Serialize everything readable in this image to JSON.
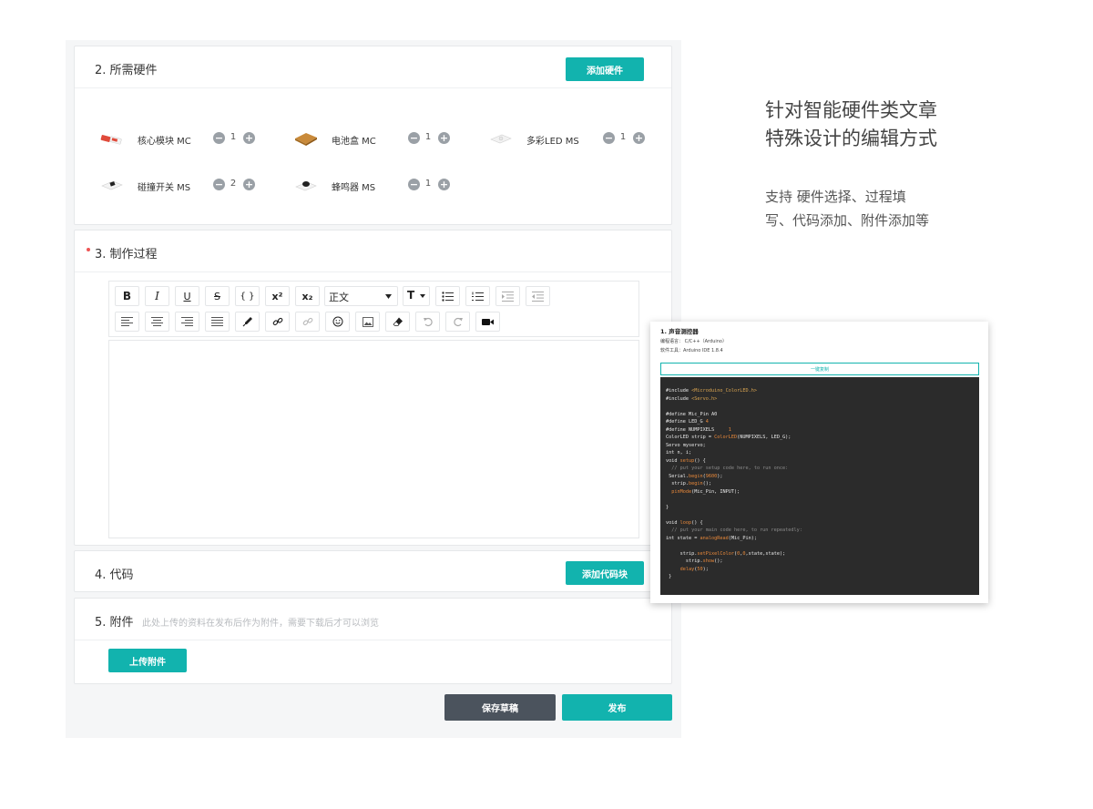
{
  "sections": {
    "hardware": {
      "title": "2. 所需硬件",
      "add_button": "添加硬件",
      "items": [
        {
          "name": "核心模块 MC",
          "count": "1",
          "icon": "core-module-icon"
        },
        {
          "name": "电池盒 MC",
          "count": "1",
          "icon": "battery-box-icon"
        },
        {
          "name": "多彩LED MS",
          "count": "1",
          "icon": "led-module-icon"
        },
        {
          "name": "碰撞开关 MS",
          "count": "2",
          "icon": "crash-switch-icon"
        },
        {
          "name": "蜂鸣器 MS",
          "count": "1",
          "icon": "buzzer-icon"
        }
      ],
      "minus_glyph": "−",
      "plus_glyph": "+"
    },
    "process": {
      "title": "3. 制作过程",
      "format_select": "正文"
    },
    "code": {
      "title": "4. 代码",
      "add_button": "添加代码块"
    },
    "attachments": {
      "title": "5. 附件",
      "note": "此处上传的资料在发布后作为附件，需要下载后才可以浏览",
      "upload_button": "上传附件"
    }
  },
  "footer": {
    "save_draft": "保存草稿",
    "publish": "发布"
  },
  "side": {
    "title_line1": "针对智能硬件类文章",
    "title_line2": "特殊设计的编辑方式",
    "desc_line1": "支持 硬件选择、过程填",
    "desc_line2": "写、代码添加、附件添加等"
  },
  "code_card": {
    "title": "1. 声音测控器",
    "language": "编程语言： C/C++（Arduino）",
    "tool": "软件工具：Arduino IDE 1.8.4",
    "copy_button": "一键复制",
    "code_lines": [
      "#include <Microduino_ColorLED.h>",
      "#include <Servo.h>",
      "",
      "#define Mic_Pin A0",
      "#define LED_G 4",
      "#define NUMPIXELS     1",
      "ColorLED strip = ColorLED(NUMPIXELS, LED_G);",
      "Servo myservo;",
      "int n, i;",
      "void setup() {",
      "  // put your setup code here, to run once:",
      " Serial.begin(9600);",
      "  strip.begin();",
      "  pinMode(Mic_Pin, INPUT);",
      "",
      "}",
      "",
      "void loop() {",
      "  // put your main code here, to run repeatedly:",
      "int state = analogRead(Mic_Pin);",
      "",
      "     strip.setPixelColor(0,0,state,state);",
      "       strip.show();",
      "     delay(50);",
      " }"
    ]
  },
  "colors": {
    "accent": "#12b3ae",
    "dark_button": "#4b535d",
    "panel_bg": "#f5f6f7",
    "code_bg": "#2b2b2b"
  }
}
